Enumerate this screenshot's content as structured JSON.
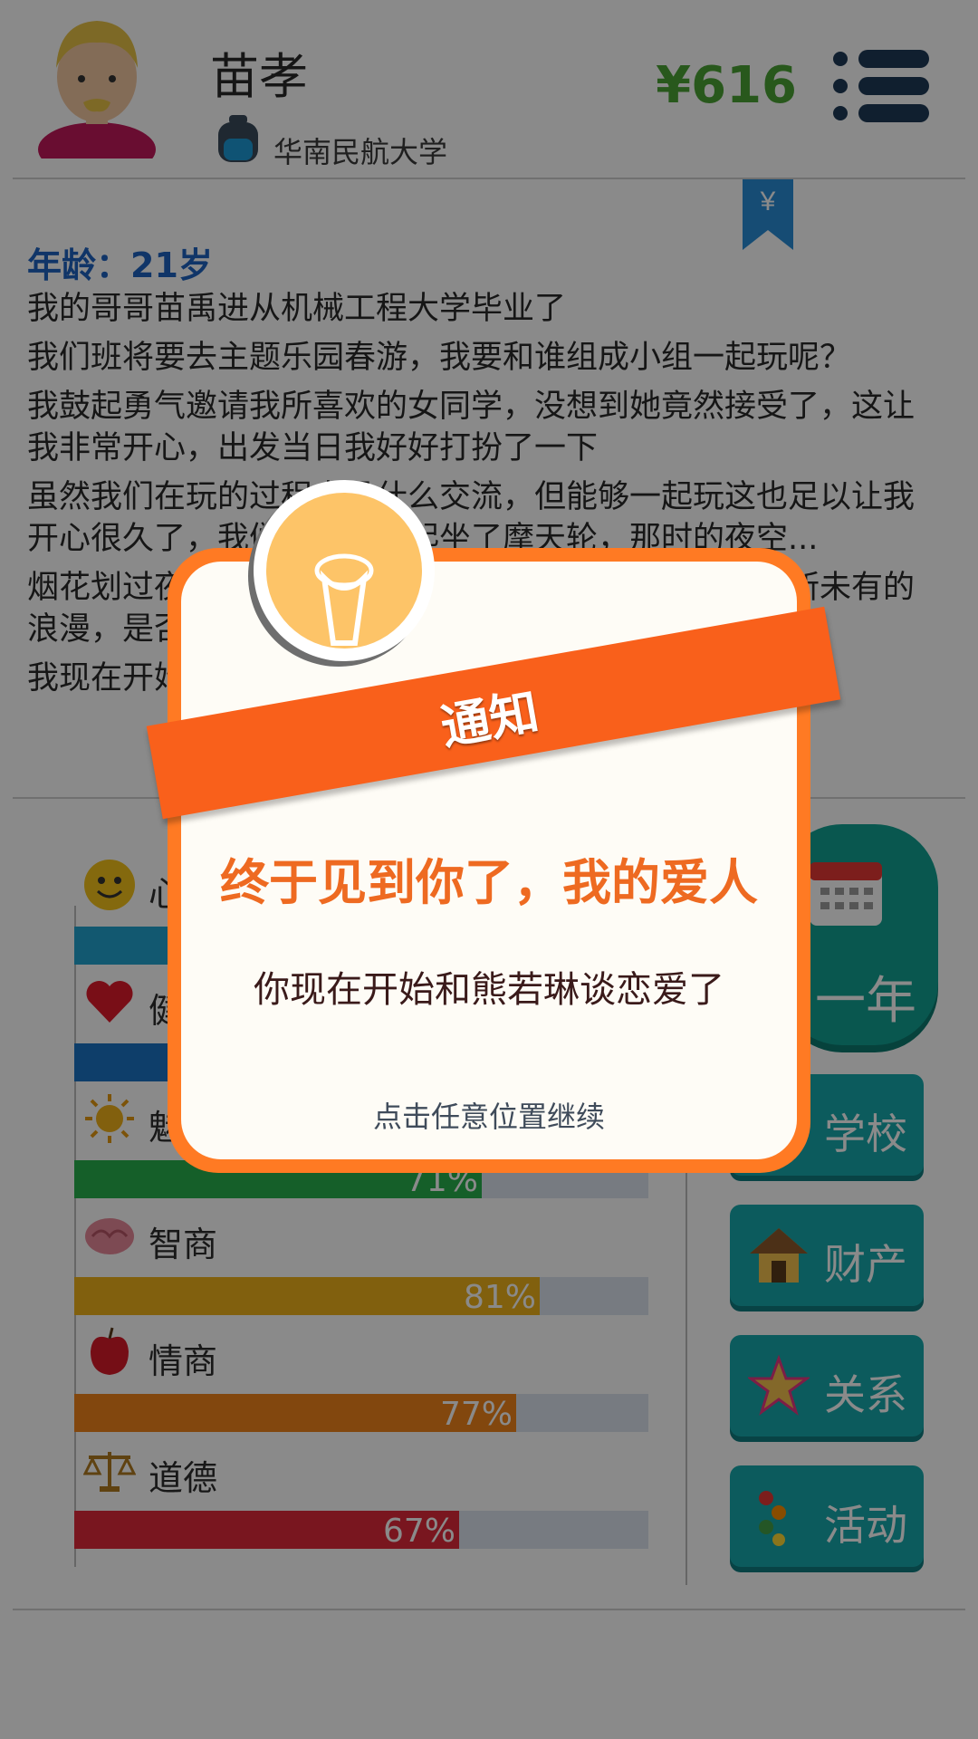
{
  "header": {
    "name": "苗孝",
    "school": "华南民航大学",
    "money": "¥616"
  },
  "bookmark": {
    "symbol": "¥"
  },
  "story": {
    "age": "年龄：21岁",
    "paragraphs": [
      "我的哥哥苗禹进从机械工程大学毕业了",
      "我们班将要去主题乐园春游，我要和谁组成小组一起玩呢？",
      "我鼓起勇气邀请我所喜欢的女同学，没想到她竟然接受了，这让我非常开心，出发当日我好好打扮了一下",
      "虽然我们在玩的过程中没什么交流，但能够一起玩这也足以让我开心很久了，我们甚至还一起坐了摩天轮，那时的夜空...",
      "烟花划过夜空，我们一起看着烟花，我感受到了一种前所未有的浪漫，是否要和她表白呢？",
      "我现在开始和熊若琳谈恋爱了"
    ]
  },
  "stats": [
    {
      "label": "心情",
      "percent": 56,
      "pct_text": "",
      "icon": "smiley-icon",
      "color": "#22a3cf"
    },
    {
      "label": "健康",
      "percent": 60,
      "pct_text": "",
      "icon": "heart-icon",
      "color": "#1a74c4"
    },
    {
      "label": "魅力",
      "percent": 71,
      "pct_text": "71%",
      "icon": "sun-icon",
      "color": "#27b04c"
    },
    {
      "label": "智商",
      "percent": 81,
      "pct_text": "81%",
      "icon": "brain-icon",
      "color": "#eeb21b"
    },
    {
      "label": "情商",
      "percent": 77,
      "pct_text": "77%",
      "icon": "apple-icon",
      "color": "#f0841a"
    },
    {
      "label": "道德",
      "percent": 67,
      "pct_text": "67%",
      "icon": "scale-icon",
      "color": "#e02a3a"
    }
  ],
  "right_panel": {
    "next_year_label": "一年",
    "buttons": [
      {
        "label": "学校",
        "icon": "school-icon"
      },
      {
        "label": "财产",
        "icon": "house-icon"
      },
      {
        "label": "关系",
        "icon": "star-icon"
      },
      {
        "label": "活动",
        "icon": "activity-icon"
      }
    ]
  },
  "dialog": {
    "ribbon": "通知",
    "title": "终于见到你了，我的爱人",
    "message": "你现在开始和熊若琳谈恋爱了",
    "hint": "点击任意位置继续"
  },
  "colors": {
    "money": "#4aa335",
    "accent": "#f9601b",
    "teal": "#17a9ac",
    "age_blue": "#1f63c0"
  }
}
